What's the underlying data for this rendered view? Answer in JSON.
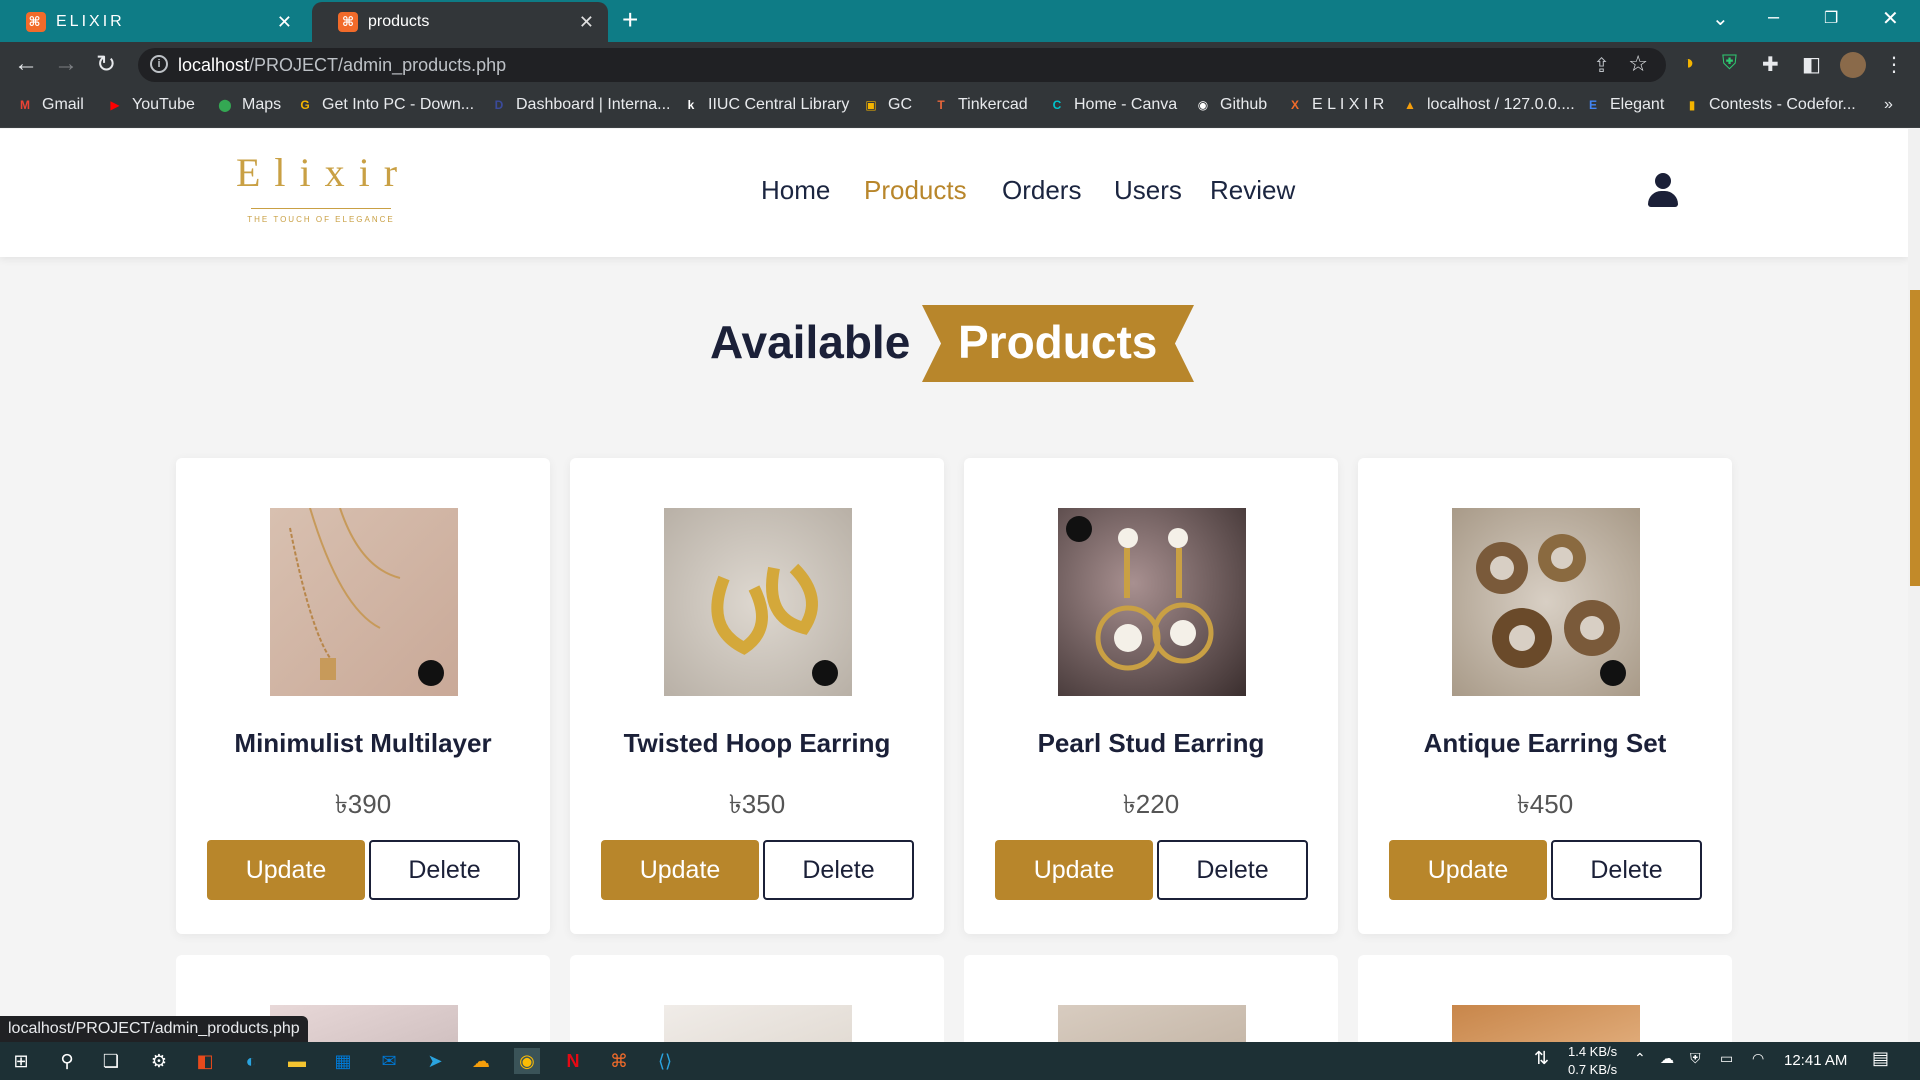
{
  "browser": {
    "tabs": [
      {
        "label": "ELIXIR"
      },
      {
        "label": "products"
      }
    ],
    "url_host": "localhost",
    "url_path": "/PROJECT/admin_products.php",
    "bookmarks": [
      {
        "label": "Gmail",
        "color": "#ea4335",
        "icon": "M"
      },
      {
        "label": "YouTube",
        "color": "#ff0000",
        "icon": "▶"
      },
      {
        "label": "Maps",
        "color": "#34a853",
        "icon": "⬤"
      },
      {
        "label": "Get Into PC - Down...",
        "color": "#f4b400",
        "icon": "G"
      },
      {
        "label": "Dashboard | Interna...",
        "color": "#3b4a9b",
        "icon": "D"
      },
      {
        "label": "IIUC Central Library",
        "color": "#ffffff",
        "icon": "k"
      },
      {
        "label": "GC",
        "color": "#f4b400",
        "icon": "▣"
      },
      {
        "label": "Tinkercad",
        "color": "#e8663b",
        "icon": "T"
      },
      {
        "label": "Home - Canva",
        "color": "#00c4cc",
        "icon": "C"
      },
      {
        "label": "Github",
        "color": "#ffffff",
        "icon": "◉"
      },
      {
        "label": "E L I X I R",
        "color": "#f26b2a",
        "icon": "X"
      },
      {
        "label": "localhost / 127.0.0....",
        "color": "#f59e0b",
        "icon": "▲"
      },
      {
        "label": "Elegant",
        "color": "#4285f4",
        "icon": "E"
      },
      {
        "label": "Contests - Codefor...",
        "color": "#f4b400",
        "icon": "▮"
      }
    ],
    "overflow_label": "»",
    "status_url": "localhost/PROJECT/admin_products.php"
  },
  "site": {
    "logo_text": "Elixir",
    "logo_tagline": "THE TOUCH OF ELEGANCE",
    "nav": [
      {
        "label": "Home"
      },
      {
        "label": "Products"
      },
      {
        "label": "Orders"
      },
      {
        "label": "Users"
      },
      {
        "label": "Review"
      }
    ],
    "active_nav": "Products"
  },
  "heading": {
    "part1": "Available",
    "part2": "Products"
  },
  "products": [
    {
      "name": "Minimulist Multilayer",
      "price": "৳390",
      "update_label": "Update",
      "delete_label": "Delete"
    },
    {
      "name": "Twisted Hoop Earring",
      "price": "৳350",
      "update_label": "Update",
      "delete_label": "Delete"
    },
    {
      "name": "Pearl Stud Earring",
      "price": "৳220",
      "update_label": "Update",
      "delete_label": "Delete"
    },
    {
      "name": "Antique Earring Set",
      "price": "৳450",
      "update_label": "Update",
      "delete_label": "Delete"
    }
  ],
  "taskbar": {
    "net_down": "1.4 KB/s",
    "net_up": "0.7 KB/s",
    "time": "12:41 AM"
  },
  "colors": {
    "accent": "#b8862b",
    "dark": "#1b2038",
    "tabstrip": "#0e7c86"
  }
}
